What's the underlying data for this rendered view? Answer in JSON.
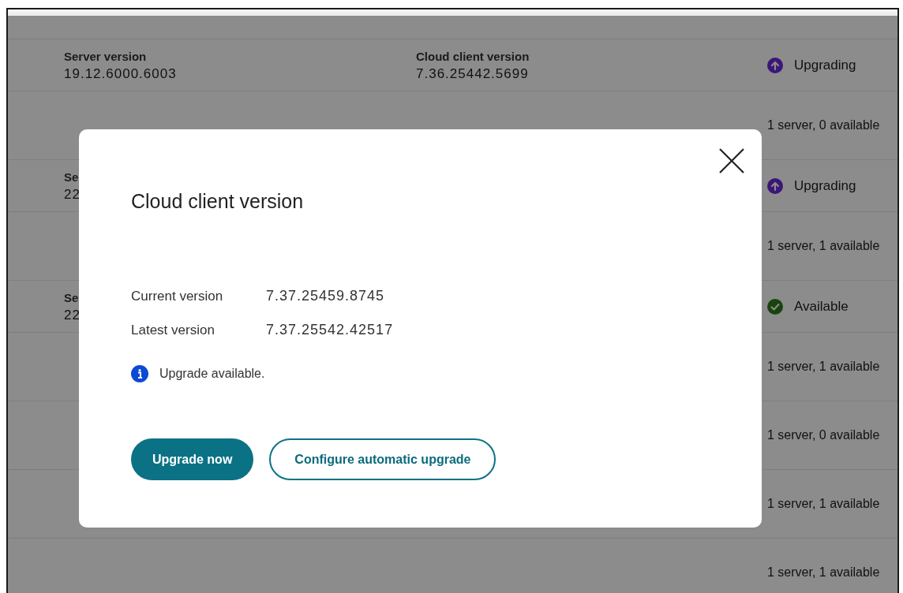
{
  "table": {
    "rows": [
      {
        "kind": "versions",
        "columns": [
          {
            "label": "Server version",
            "value": "19.12.6000.6003"
          },
          {
            "label": "Cloud client version",
            "value": "7.36.25442.5699"
          }
        ],
        "status": {
          "kind": "upgrading",
          "text": "Upgrading"
        }
      },
      {
        "kind": "summary",
        "text": "1 server, 0 available"
      },
      {
        "kind": "versions",
        "columns": [
          {
            "label": "Se",
            "value": "22"
          }
        ],
        "status": {
          "kind": "upgrading",
          "text": "Upgrading"
        }
      },
      {
        "kind": "summary",
        "text": "1 server, 1 available"
      },
      {
        "kind": "versions",
        "columns": [
          {
            "label": "Se",
            "value": "22"
          }
        ],
        "status": {
          "kind": "available",
          "text": "Available"
        }
      },
      {
        "kind": "summary",
        "text": "1 server, 1 available"
      },
      {
        "kind": "summary",
        "text": "1 server, 0 available"
      },
      {
        "kind": "summary",
        "text": "1 server, 1 available"
      },
      {
        "kind": "summary",
        "text": "1 server, 1 available"
      }
    ]
  },
  "dialog": {
    "title": "Cloud client version",
    "fields": [
      {
        "label": "Current version",
        "value": "7.37.25459.8745"
      },
      {
        "label": "Latest version",
        "value": "7.37.25542.42517"
      }
    ],
    "message": {
      "kind": "info",
      "text": "Upgrade available."
    },
    "buttons": [
      {
        "kind": "primary",
        "label": "Upgrade now"
      },
      {
        "kind": "secondary",
        "label": "Configure automatic upgrade"
      }
    ]
  }
}
